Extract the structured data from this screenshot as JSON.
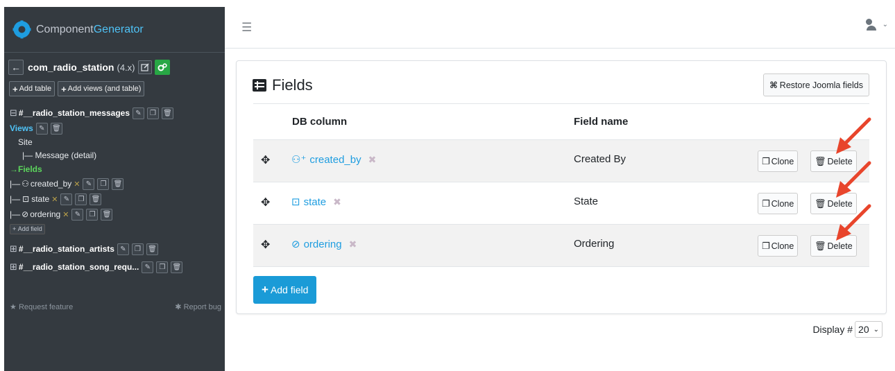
{
  "brand": {
    "name_part1": "Component",
    "name_part2": "Generator"
  },
  "component": {
    "name": "com_radio_station",
    "version": "(4.x)"
  },
  "sidebar_buttons": {
    "add_table": "Add table",
    "add_views": "Add views (and table)"
  },
  "tree": {
    "table1": "#__radio_station_messages",
    "views_label": "Views",
    "site_label": "Site",
    "message_view": "|— Message (detail)",
    "fields_label": "Fields",
    "field_items": [
      {
        "prefix": "|—",
        "name": "created_by"
      },
      {
        "prefix": "|—",
        "name": "state"
      },
      {
        "prefix": "|—",
        "name": "ordering"
      }
    ],
    "add_field_small": "Add field",
    "table2": "#__radio_station_artists",
    "table3": "#__radio_station_song_requ..."
  },
  "footer": {
    "request_feature": "Request feature",
    "report_bug": "Report bug"
  },
  "card": {
    "title": "Fields",
    "restore_button": "Restore Joomla fields"
  },
  "table": {
    "headers": {
      "db_column": "DB column",
      "field_name": "Field name"
    },
    "rows": [
      {
        "db_column": "created_by",
        "field_name": "Created By",
        "icon": "user-plus-icon"
      },
      {
        "db_column": "state",
        "field_name": "State",
        "icon": "dropdown-box-icon"
      },
      {
        "db_column": "ordering",
        "field_name": "Ordering",
        "icon": "eye-slash-icon"
      }
    ],
    "clone_label": "Clone",
    "delete_label": "Delete"
  },
  "add_field_button": "Add field",
  "display": {
    "label": "Display #",
    "value": "20"
  },
  "colors": {
    "sidebar_bg": "#343a40",
    "link_blue": "#1e9de0",
    "primary_btn": "#1a9bd7",
    "accent_green": "#28a745",
    "annotation_red": "#e8452c"
  }
}
